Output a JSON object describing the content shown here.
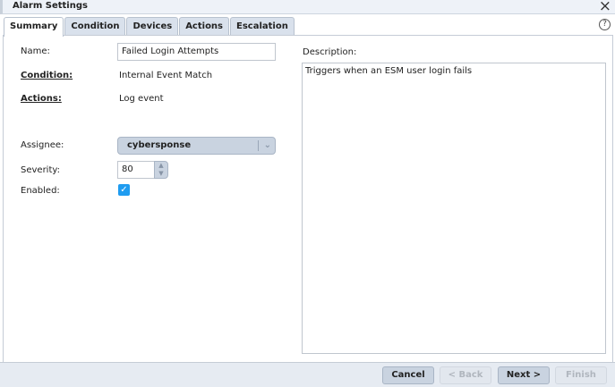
{
  "window": {
    "title": "Alarm Settings",
    "close_icon": "×",
    "help_icon": "?"
  },
  "tabs": [
    {
      "label": "Summary",
      "active": true
    },
    {
      "label": "Condition"
    },
    {
      "label": "Devices"
    },
    {
      "label": "Actions"
    },
    {
      "label": "Escalation"
    }
  ],
  "form": {
    "name_label": "Name:",
    "name_value": "Failed Login Attempts",
    "condition_label": "Condition:",
    "condition_value": "Internal Event Match",
    "actions_label": "Actions:",
    "actions_value": "Log event",
    "assignee_label": "Assignee:",
    "assignee_value": "cybersponse",
    "severity_label": "Severity:",
    "severity_value": "80",
    "enabled_label": "Enabled:",
    "enabled": true,
    "description_label": "Description:",
    "description_value": "Triggers when an ESM user login fails"
  },
  "footer": {
    "cancel": "Cancel",
    "back": "< Back",
    "next": "Next >",
    "finish": "Finish"
  }
}
